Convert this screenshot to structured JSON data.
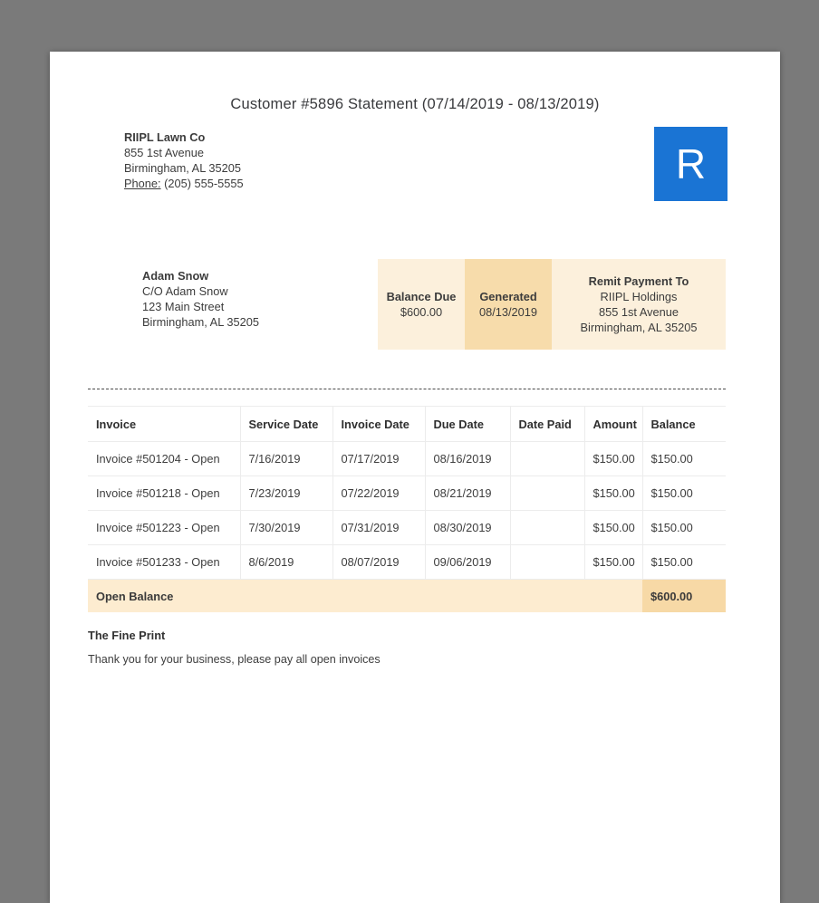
{
  "page": {
    "title": "Customer #5896 Statement (07/14/2019 - 08/13/2019)"
  },
  "company": {
    "name": "RIIPL Lawn Co",
    "address1": "855 1st Avenue",
    "address2": "Birmingham, AL 35205",
    "phone_label": "Phone:",
    "phone": "(205) 555-5555"
  },
  "logo": {
    "letter": "R",
    "color": "#1a74d4"
  },
  "customer": {
    "name": "Adam Snow",
    "line1": "C/O Adam Snow",
    "line2": "123 Main Street",
    "line3": "Birmingham, AL 35205"
  },
  "summary": {
    "balance_due_label": "Balance Due",
    "balance_due_value": "$600.00",
    "generated_label": "Generated",
    "generated_value": "08/13/2019",
    "remit_label": "Remit Payment To",
    "remit_name": "RIIPL Holdings",
    "remit_address1": "855 1st Avenue",
    "remit_address2": "Birmingham, AL 35205"
  },
  "table": {
    "headers": [
      "Invoice",
      "Service Date",
      "Invoice Date",
      "Due Date",
      "Date Paid",
      "Amount",
      "Balance"
    ],
    "rows": [
      [
        "Invoice #501204 - Open",
        "7/16/2019",
        "07/17/2019",
        "08/16/2019",
        "",
        "$150.00",
        "$150.00"
      ],
      [
        "Invoice #501218 - Open",
        "7/23/2019",
        "07/22/2019",
        "08/21/2019",
        "",
        "$150.00",
        "$150.00"
      ],
      [
        "Invoice #501223 - Open",
        "7/30/2019",
        "07/31/2019",
        "08/30/2019",
        "",
        "$150.00",
        "$150.00"
      ],
      [
        "Invoice #501233 - Open",
        "8/6/2019",
        "08/07/2019",
        "09/06/2019",
        "",
        "$150.00",
        "$150.00"
      ]
    ],
    "footer_label": "Open Balance",
    "footer_balance": "$600.00"
  },
  "fine_print": {
    "heading": "The Fine Print",
    "text": "Thank you for your business, please pay all open invoices"
  },
  "colors": {
    "logo_blue": "#1a74d4",
    "highlight_light": "#fcf0dc",
    "highlight_dark": "#f7dcab",
    "footer_row": "#fdecd0",
    "footer_balance": "#f7d9a6",
    "backdrop": "#7a7a7a"
  }
}
